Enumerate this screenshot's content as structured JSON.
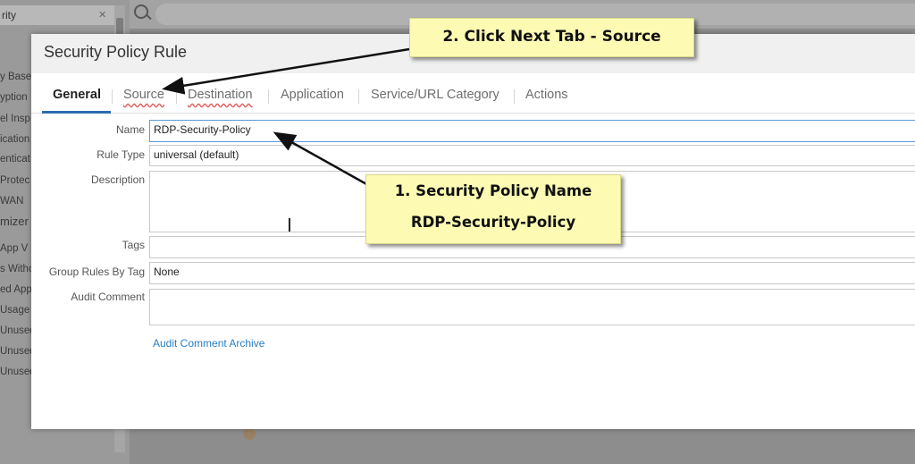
{
  "sidebar": {
    "top_item": "rity",
    "items": [
      "y Base",
      "yption",
      "el Insp",
      "ication",
      "enticat",
      "Protec",
      "WAN",
      "mizer",
      "App V",
      "s Witho",
      "ed App",
      "Usage",
      "Unused",
      "Unused",
      "Unused"
    ]
  },
  "dialog": {
    "title": "Security Policy Rule",
    "tabs": [
      {
        "label": "General",
        "active": true
      },
      {
        "label": "Source",
        "active": false
      },
      {
        "label": "Destination",
        "active": false
      },
      {
        "label": "Application",
        "active": false
      },
      {
        "label": "Service/URL Category",
        "active": false
      },
      {
        "label": "Actions",
        "active": false
      }
    ],
    "form": {
      "name": {
        "label": "Name",
        "value": "RDP-Security-Policy"
      },
      "rule_type": {
        "label": "Rule Type",
        "value": "universal (default)"
      },
      "description": {
        "label": "Description",
        "value": ""
      },
      "tags": {
        "label": "Tags",
        "value": ""
      },
      "group_rules_by_tag": {
        "label": "Group Rules By Tag",
        "value": "None"
      },
      "audit_comment": {
        "label": "Audit Comment",
        "value": ""
      }
    },
    "audit_comment_archive_link": "Audit Comment Archive"
  },
  "annotations": {
    "callout_tab": "2. Click Next Tab - Source",
    "callout_name_line1": "1. Security Policy Name",
    "callout_name_line2": "RDP-Security-Policy"
  },
  "colors": {
    "accent": "#2b6cb0",
    "link": "#2a7ec4",
    "callout_bg": "#fdfbb3",
    "error_underline": "#e06060"
  }
}
